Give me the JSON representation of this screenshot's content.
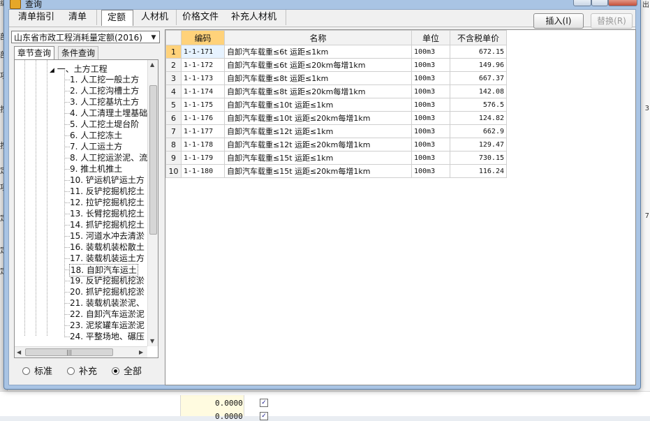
{
  "background": {
    "left_fragments": [
      "编",
      "部",
      "部",
      "项",
      "按",
      "按",
      "定",
      "项",
      "定",
      "定",
      "定"
    ],
    "right_fragments": [
      "出",
      "3",
      "7"
    ],
    "bottom_values": [
      "0.0000",
      "0.0000"
    ]
  },
  "window": {
    "title": "查询",
    "tabs": [
      "清单指引",
      "清单",
      "定额",
      "人材机",
      "价格文件",
      "补充人材机"
    ],
    "active_tab": "定额",
    "insert_button": "插入(I)",
    "replace_button": "替换(R)"
  },
  "left_panel": {
    "quota_library": "山东省市政工程消耗量定额(2016)",
    "subtabs": [
      "章节查询",
      "条件查询"
    ],
    "tree_root": "一、土方工程",
    "tree_items": [
      "1. 人工挖一般土方",
      "2. 人工挖沟槽土方",
      "3. 人工挖基坑土方",
      "4. 人工清理土埋基础",
      "5. 人工挖土堤台阶",
      "6. 人工挖冻土",
      "7. 人工运土方",
      "8. 人工挖运淤泥、流",
      "9. 推土机推土",
      "10. 铲运机铲运土方",
      "11. 反铲挖掘机挖土",
      "12. 拉铲挖掘机挖土",
      "13. 长臂挖掘机挖土",
      "14. 抓铲挖掘机挖土",
      "15. 河道水冲去清淤",
      "16. 装载机装松散土",
      "17. 装载机装运土方",
      "18. 自卸汽车运土",
      "19. 反铲挖掘机挖淤",
      "20. 抓铲挖掘机挖淤",
      "21. 装载机装淤泥、",
      "22. 自卸汽车运淤泥",
      "23. 泥浆罐车运淤泥",
      "24. 平整场地、碾压"
    ],
    "selected_item": "18. 自卸汽车运土",
    "filter_options": [
      "标准",
      "补充",
      "全部"
    ],
    "filter_selected": "全部"
  },
  "grid": {
    "columns": [
      "编码",
      "名称",
      "单位",
      "不含税单价"
    ],
    "rows": [
      {
        "no": "1",
        "code": "1-1-171",
        "name": "自卸汽车载重≤6t 运距≤1km",
        "unit": "100m3",
        "price": "672.15"
      },
      {
        "no": "2",
        "code": "1-1-172",
        "name": "自卸汽车载重≤6t 运距≤20km每增1km",
        "unit": "100m3",
        "price": "149.96"
      },
      {
        "no": "3",
        "code": "1-1-173",
        "name": "自卸汽车载重≤8t 运距≤1km",
        "unit": "100m3",
        "price": "667.37"
      },
      {
        "no": "4",
        "code": "1-1-174",
        "name": "自卸汽车载重≤8t 运距≤20km每增1km",
        "unit": "100m3",
        "price": "142.08"
      },
      {
        "no": "5",
        "code": "1-1-175",
        "name": "自卸汽车载重≤10t 运距≤1km",
        "unit": "100m3",
        "price": "576.5"
      },
      {
        "no": "6",
        "code": "1-1-176",
        "name": "自卸汽车载重≤10t 运距≤20km每增1km",
        "unit": "100m3",
        "price": "124.82"
      },
      {
        "no": "7",
        "code": "1-1-177",
        "name": "自卸汽车载重≤12t 运距≤1km",
        "unit": "100m3",
        "price": "662.9"
      },
      {
        "no": "8",
        "code": "1-1-178",
        "name": "自卸汽车载重≤12t 运距≤20km每增1km",
        "unit": "100m3",
        "price": "129.47"
      },
      {
        "no": "9",
        "code": "1-1-179",
        "name": "自卸汽车载重≤15t 运距≤1km",
        "unit": "100m3",
        "price": "730.15"
      },
      {
        "no": "10",
        "code": "1-1-180",
        "name": "自卸汽车载重≤15t 运距≤20km每增1km",
        "unit": "100m3",
        "price": "116.24"
      }
    ]
  }
}
